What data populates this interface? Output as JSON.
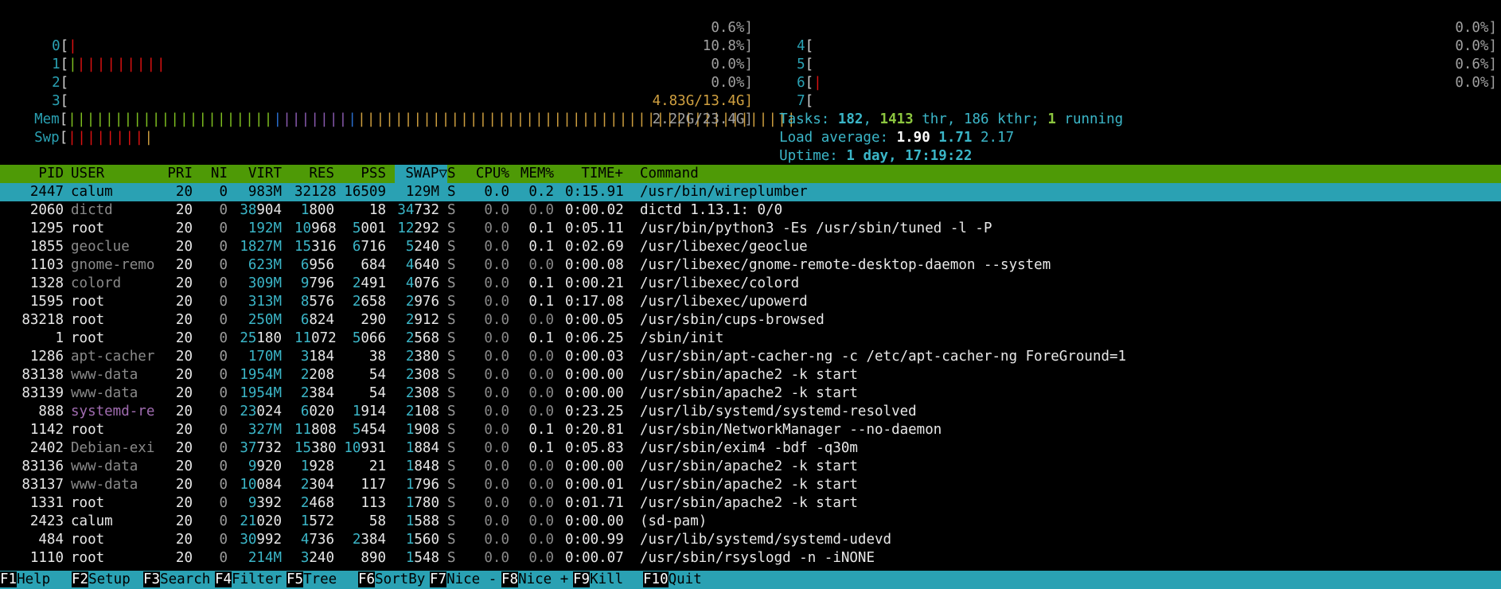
{
  "meters": {
    "cpu_left": [
      {
        "id": "0",
        "pct": "0.6%]",
        "bars": "|"
      },
      {
        "id": "1",
        "pct": "10.8%]",
        "bars": "||||||||||"
      },
      {
        "id": "2",
        "pct": "0.0%]",
        "bars": ""
      },
      {
        "id": "3",
        "pct": "0.0%]",
        "bars": ""
      }
    ],
    "cpu_right": [
      {
        "id": "4",
        "pct": "0.0%]",
        "bars": ""
      },
      {
        "id": "5",
        "pct": "0.0%]",
        "bars": ""
      },
      {
        "id": "6",
        "pct": "0.6%]",
        "bars": "|"
      },
      {
        "id": "7",
        "pct": "0.0%]",
        "bars": ""
      }
    ],
    "mem_label": "Mem",
    "mem_value": "4.83G/13.4G]",
    "swp_label": "Swp",
    "swp_value": "2.22G/23.4G]"
  },
  "summary": {
    "tasks_label": "Tasks:",
    "tasks": "182",
    "thr": "1413",
    "thr_label": "thr,",
    "kthr": "186 kthr;",
    "running": "1",
    "running_label": "running",
    "load_label": "Load average:",
    "load1": "1.90",
    "load5": "1.71",
    "load15": "2.17",
    "uptime_label": "Uptime:",
    "uptime": "1 day, 17:19:22"
  },
  "columns": {
    "pid": "PID",
    "user": "USER",
    "pri": "PRI",
    "ni": "NI",
    "virt": "VIRT",
    "res": "RES",
    "pss": "PSS",
    "swap": "SWAP▽",
    "s": "S",
    "cpu": "CPU%",
    "mem": "MEM%",
    "time": "TIME+",
    "command": "Command"
  },
  "processes": [
    {
      "pid": "2447",
      "user": "calum",
      "pri": "20",
      "ni": "0",
      "virt": "983M",
      "res": "32128",
      "pss": "16509",
      "swap": "129M",
      "s": "S",
      "cpu": "0.0",
      "mem": "0.2",
      "time": "0:15.91",
      "command": "/usr/bin/wireplumber"
    },
    {
      "pid": "2060",
      "user": "dictd",
      "pri": "20",
      "ni": "0",
      "virt": "38904",
      "res": "1800",
      "pss": "18",
      "swap": "34732",
      "s": "S",
      "cpu": "0.0",
      "mem": "0.0",
      "time": "0:00.02",
      "command": "dictd 1.13.1: 0/0"
    },
    {
      "pid": "1295",
      "user": "root",
      "pri": "20",
      "ni": "0",
      "virt": "192M",
      "res": "10968",
      "pss": "5001",
      "swap": "12292",
      "s": "S",
      "cpu": "0.0",
      "mem": "0.1",
      "time": "0:05.11",
      "command": "/usr/bin/python3 -Es /usr/sbin/tuned -l -P"
    },
    {
      "pid": "1855",
      "user": "geoclue",
      "pri": "20",
      "ni": "0",
      "virt": "1827M",
      "res": "15316",
      "pss": "6716",
      "swap": "5240",
      "s": "S",
      "cpu": "0.0",
      "mem": "0.1",
      "time": "0:02.69",
      "command": "/usr/libexec/geoclue"
    },
    {
      "pid": "1103",
      "user": "gnome-remo",
      "pri": "20",
      "ni": "0",
      "virt": "623M",
      "res": "6956",
      "pss": "684",
      "swap": "4640",
      "s": "S",
      "cpu": "0.0",
      "mem": "0.0",
      "time": "0:00.08",
      "command": "/usr/libexec/gnome-remote-desktop-daemon --system"
    },
    {
      "pid": "1328",
      "user": "colord",
      "pri": "20",
      "ni": "0",
      "virt": "309M",
      "res": "9796",
      "pss": "2491",
      "swap": "4076",
      "s": "S",
      "cpu": "0.0",
      "mem": "0.1",
      "time": "0:00.21",
      "command": "/usr/libexec/colord"
    },
    {
      "pid": "1595",
      "user": "root",
      "pri": "20",
      "ni": "0",
      "virt": "313M",
      "res": "8576",
      "pss": "2658",
      "swap": "2976",
      "s": "S",
      "cpu": "0.0",
      "mem": "0.1",
      "time": "0:17.08",
      "command": "/usr/libexec/upowerd"
    },
    {
      "pid": "83218",
      "user": "root",
      "pri": "20",
      "ni": "0",
      "virt": "250M",
      "res": "6824",
      "pss": "290",
      "swap": "2912",
      "s": "S",
      "cpu": "0.0",
      "mem": "0.0",
      "time": "0:00.05",
      "command": "/usr/sbin/cups-browsed"
    },
    {
      "pid": "1",
      "user": "root",
      "pri": "20",
      "ni": "0",
      "virt": "25180",
      "res": "11072",
      "pss": "5066",
      "swap": "2568",
      "s": "S",
      "cpu": "0.0",
      "mem": "0.1",
      "time": "0:06.25",
      "command": "/sbin/init"
    },
    {
      "pid": "1286",
      "user": "apt-cacher",
      "pri": "20",
      "ni": "0",
      "virt": "170M",
      "res": "3184",
      "pss": "38",
      "swap": "2380",
      "s": "S",
      "cpu": "0.0",
      "mem": "0.0",
      "time": "0:00.03",
      "command": "/usr/sbin/apt-cacher-ng -c /etc/apt-cacher-ng ForeGround=1"
    },
    {
      "pid": "83138",
      "user": "www-data",
      "pri": "20",
      "ni": "0",
      "virt": "1954M",
      "res": "2208",
      "pss": "54",
      "swap": "2308",
      "s": "S",
      "cpu": "0.0",
      "mem": "0.0",
      "time": "0:00.00",
      "command": "/usr/sbin/apache2 -k start"
    },
    {
      "pid": "83139",
      "user": "www-data",
      "pri": "20",
      "ni": "0",
      "virt": "1954M",
      "res": "2384",
      "pss": "54",
      "swap": "2308",
      "s": "S",
      "cpu": "0.0",
      "mem": "0.0",
      "time": "0:00.00",
      "command": "/usr/sbin/apache2 -k start"
    },
    {
      "pid": "888",
      "user": "systemd-re",
      "pri": "20",
      "ni": "0",
      "virt": "23024",
      "res": "6020",
      "pss": "1914",
      "swap": "2108",
      "s": "S",
      "cpu": "0.0",
      "mem": "0.0",
      "time": "0:23.25",
      "command": "/usr/lib/systemd/systemd-resolved"
    },
    {
      "pid": "1142",
      "user": "root",
      "pri": "20",
      "ni": "0",
      "virt": "327M",
      "res": "11808",
      "pss": "5454",
      "swap": "1908",
      "s": "S",
      "cpu": "0.0",
      "mem": "0.1",
      "time": "0:20.81",
      "command": "/usr/sbin/NetworkManager --no-daemon"
    },
    {
      "pid": "2402",
      "user": "Debian-exi",
      "pri": "20",
      "ni": "0",
      "virt": "37732",
      "res": "15380",
      "pss": "10931",
      "swap": "1884",
      "s": "S",
      "cpu": "0.0",
      "mem": "0.1",
      "time": "0:05.83",
      "command": "/usr/sbin/exim4 -bdf -q30m"
    },
    {
      "pid": "83136",
      "user": "www-data",
      "pri": "20",
      "ni": "0",
      "virt": "9920",
      "res": "1928",
      "pss": "21",
      "swap": "1848",
      "s": "S",
      "cpu": "0.0",
      "mem": "0.0",
      "time": "0:00.00",
      "command": "/usr/sbin/apache2 -k start"
    },
    {
      "pid": "83137",
      "user": "www-data",
      "pri": "20",
      "ni": "0",
      "virt": "10084",
      "res": "2304",
      "pss": "117",
      "swap": "1796",
      "s": "S",
      "cpu": "0.0",
      "mem": "0.0",
      "time": "0:00.01",
      "command": "/usr/sbin/apache2 -k start"
    },
    {
      "pid": "1331",
      "user": "root",
      "pri": "20",
      "ni": "0",
      "virt": "9392",
      "res": "2468",
      "pss": "113",
      "swap": "1780",
      "s": "S",
      "cpu": "0.0",
      "mem": "0.0",
      "time": "0:01.71",
      "command": "/usr/sbin/apache2 -k start"
    },
    {
      "pid": "2423",
      "user": "calum",
      "pri": "20",
      "ni": "0",
      "virt": "21020",
      "res": "1572",
      "pss": "58",
      "swap": "1588",
      "s": "S",
      "cpu": "0.0",
      "mem": "0.0",
      "time": "0:00.00",
      "command": "(sd-pam)"
    },
    {
      "pid": "484",
      "user": "root",
      "pri": "20",
      "ni": "0",
      "virt": "30992",
      "res": "4736",
      "pss": "2384",
      "swap": "1560",
      "s": "S",
      "cpu": "0.0",
      "mem": "0.0",
      "time": "0:00.99",
      "command": "/usr/lib/systemd/systemd-udevd"
    },
    {
      "pid": "1110",
      "user": "root",
      "pri": "20",
      "ni": "0",
      "virt": "214M",
      "res": "3240",
      "pss": "890",
      "swap": "1548",
      "s": "S",
      "cpu": "0.0",
      "mem": "0.0",
      "time": "0:00.07",
      "command": "/usr/sbin/rsyslogd -n -iNONE"
    }
  ],
  "fkeys": [
    {
      "key": "F1",
      "label": "Help  "
    },
    {
      "key": "F2",
      "label": "Setup "
    },
    {
      "key": "F3",
      "label": "Search"
    },
    {
      "key": "F4",
      "label": "Filter"
    },
    {
      "key": "F5",
      "label": "Tree  "
    },
    {
      "key": "F6",
      "label": "SortBy"
    },
    {
      "key": "F7",
      "label": "Nice -"
    },
    {
      "key": "F8",
      "label": "Nice +"
    },
    {
      "key": "F9",
      "label": "Kill  "
    },
    {
      "key": "F10",
      "label": "Quit"
    }
  ],
  "colors": {
    "header_bg": "#4e9a06",
    "selected_bg": "#2aa1b3",
    "accent_cyan": "#3bb6c8",
    "accent_green": "#8cc63f",
    "bar_red": "#dd1111"
  }
}
